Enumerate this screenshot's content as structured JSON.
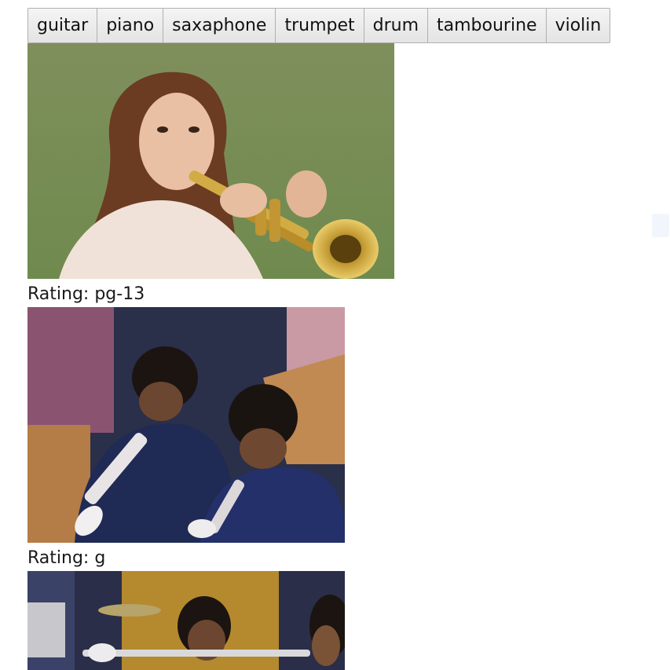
{
  "filter_bar": {
    "buttons": [
      {
        "label": "guitar"
      },
      {
        "label": "piano"
      },
      {
        "label": "saxaphone"
      },
      {
        "label": "trumpet"
      },
      {
        "label": "drum"
      },
      {
        "label": "tambourine"
      },
      {
        "label": "violin"
      }
    ]
  },
  "results": [
    {
      "rating": "Rating: pg-13"
    },
    {
      "rating": "Rating: g"
    },
    {
      "rating": ""
    }
  ]
}
